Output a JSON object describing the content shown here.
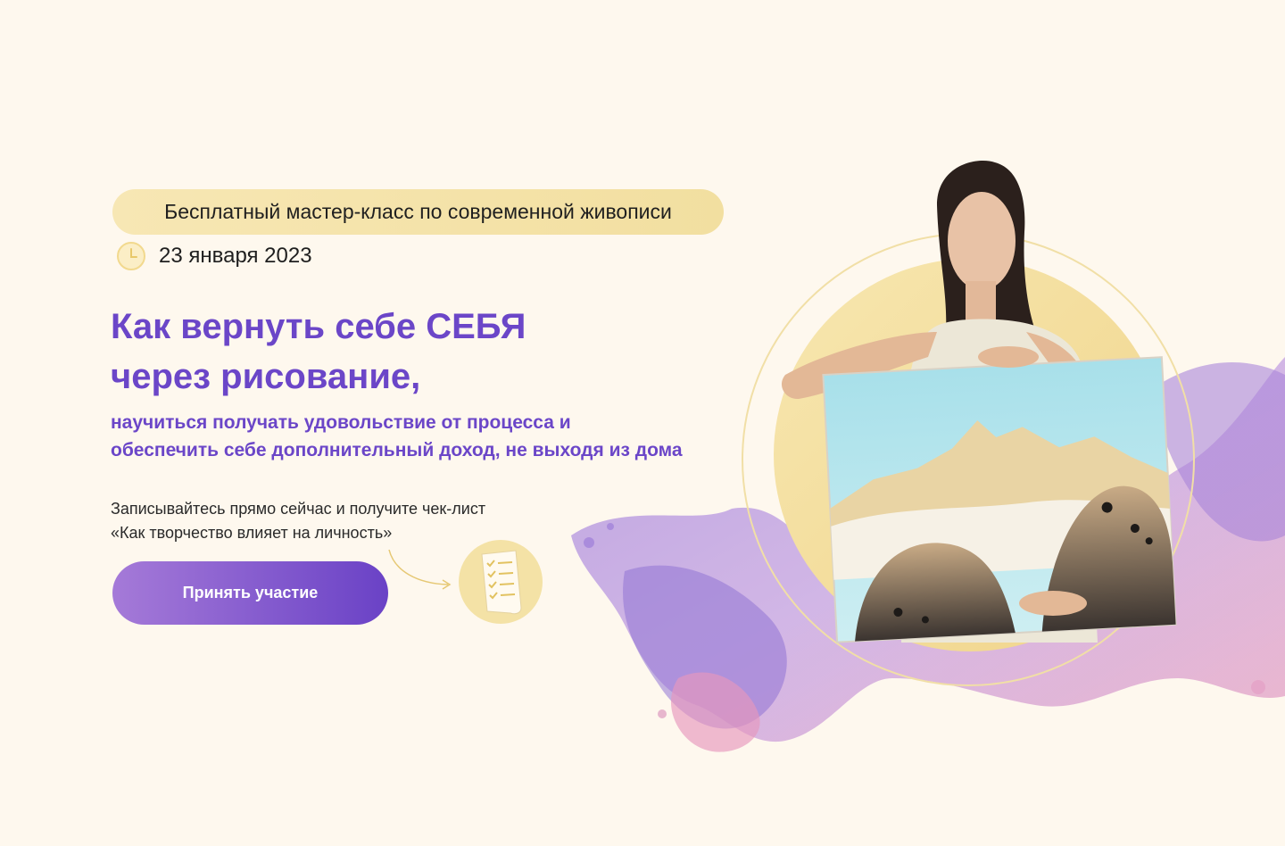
{
  "badge": {
    "text": "Бесплатный мастер-класс по современной живописи"
  },
  "event": {
    "date": "23 января 2023",
    "icon": "clock-icon"
  },
  "headline": {
    "line1": "Как вернуть себе СЕБЯ",
    "line2": "через рисование,"
  },
  "subheadline": {
    "line1": "научиться получать удовольствие от процесса и",
    "line2": "обеспечить себе дополнительный доход, не выходя из дома"
  },
  "cta": {
    "text_line1": "Записывайтесь прямо сейчас и получите чек-лист",
    "text_line2": "«Как творчество влияет на личность»",
    "button_label": "Принять участие"
  },
  "colors": {
    "background": "#fef8ee",
    "accent_purple": "#6b46c8",
    "badge_yellow": "#f5e3aa",
    "circle_yellow": "#f4de9c"
  }
}
